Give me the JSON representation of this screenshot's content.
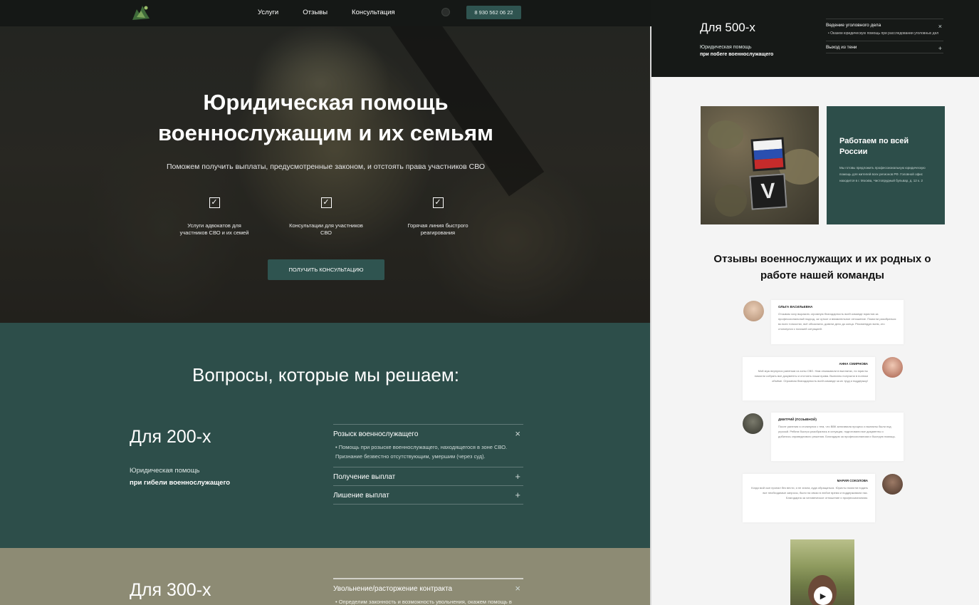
{
  "header": {
    "nav": [
      "Услуги",
      "Отзывы",
      "Консультация"
    ],
    "phone": "8 930 562 06 22"
  },
  "hero": {
    "title_line1": "Юридическая помощь",
    "title_line2": "военнослужащим и их семьям",
    "subtitle": "Поможем получить выплаты, предусмотренные законом, и отстоять права участников СВО",
    "features": [
      "Услуги адвокатов для участников СВО и их семей",
      "Консультации для участников СВО",
      "Горячая линия быстрого реагирования"
    ],
    "cta": "ПОЛУЧИТЬ КОНСУЛЬТАЦИЮ"
  },
  "questions": {
    "title": "Вопросы, которые мы решаем:",
    "block200": {
      "title": "Для 200-х",
      "sub1": "Юридическая помощь",
      "sub2": "при гибели военнослужащего",
      "items": [
        {
          "head": "Розыск военнослужащего",
          "toggle": "×",
          "body": "• Помощь при розыске военнослужащего, находящегося в зоне СВО. Признание безвестно отсутствующим, умершим (через суд)."
        },
        {
          "head": "Получение выплат",
          "toggle": "+"
        },
        {
          "head": "Лишение выплат",
          "toggle": "+"
        }
      ]
    },
    "block300": {
      "title": "Для 300-х",
      "items": [
        {
          "head": "Увольнение/расторжение контракта",
          "toggle": "×",
          "body": "• Определим законность и возможность увольнения, окажем помощь в"
        }
      ]
    }
  },
  "right": {
    "block500": {
      "title": "Для 500-х",
      "sub1": "Юридическая помощь",
      "sub2": "при побеге военнослужащего",
      "items": [
        {
          "head": "Ведение уголовного дела",
          "toggle": "×",
          "body": "• Оказем юридическую помощь при расследовании уголовных дел"
        },
        {
          "head": "Выход из тени",
          "toggle": "+"
        }
      ]
    },
    "card": {
      "title": "Работаем по всей России",
      "text": "Мы готовы предложить профессиональную юридическую помощь для жителей всех регионов РФ. Головной офис находится в г. Москва, Чистопрудный бульвар, д. 12 к. 2"
    },
    "reviews_title": "Отзывы военнослужащих и их родных о работе нашей команды",
    "reviews": [
      {
        "name": "ОЛЬГА ВАСИЛЬЕВНА",
        "text": "Отзывом хочу выразить огромную благодарность всей команде юристов за профессиональный подход, за чуткое и внимательное отношение. Помогли разобраться во всех тонкостях, всё объяснили, довели дело до конца. Рекомендую всем, кто столкнулся с похожей ситуацией."
      },
      {
        "name": "АННА СМИРНОВА",
        "text": "Мой муж вернулся раненым из зоны СВО. Нам отказывали в выплатах, но юристы помогли собрать все документы и отстоять наши права. Выплаты получили в полном объёме. Огромная благодарность всей команде за их труд и поддержку!"
      },
      {
        "name": "ДМИТРИЙ (ПОЗЫВНОЙ)",
        "text": "После ранения я столкнулся с тем, что ВВК затягивала процесс и выплаты были под угрозой. Ребята быстро разобрались в ситуации, подготовили все документы и добились справедливого решения. Благодарю за профессионализм и быструю помощь."
      },
      {
        "name": "МАРИЯ СОКОЛОВА",
        "text": "Когда мой сын пропал без вести, я не знала, куда обращаться. Юристы помогли подать все необходимые запросы, были на связи в любое время и поддерживали нас. Благодарна за человеческое отношение и профессионализм."
      }
    ],
    "play_icon": "play-icon"
  }
}
